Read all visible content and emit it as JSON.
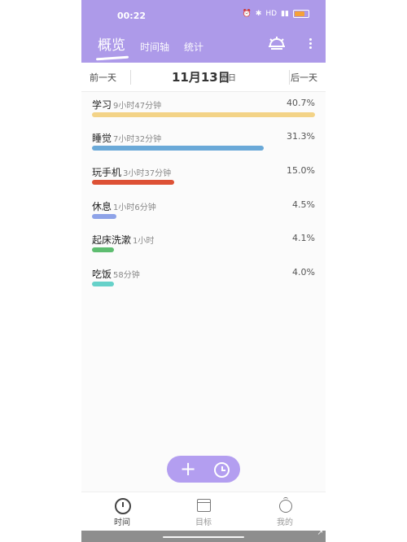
{
  "status_bar": {
    "time": "00:22",
    "icons": [
      "alarm-icon",
      "bluetooth-icon",
      "hd-icon",
      "signal-icon",
      "battery-icon"
    ]
  },
  "header": {
    "tabs": [
      "概览",
      "时间轴",
      "统计"
    ],
    "icons": [
      "sunrise-icon",
      "more-vertical-icon"
    ],
    "background": "#ad9ae9"
  },
  "date_bar": {
    "prev": "前一天",
    "date": "11月13日",
    "weekday": "周日",
    "next": "后一天"
  },
  "activities": [
    {
      "name": "学习",
      "duration": "9小时47分钟",
      "percent": "40.7%",
      "color": "#f3d387",
      "fraction": 1.0
    },
    {
      "name": "睡觉",
      "duration": "7小时32分钟",
      "percent": "31.3%",
      "color": "#6aa9d8",
      "fraction": 0.77
    },
    {
      "name": "玩手机",
      "duration": "3小时37分钟",
      "percent": "15.0%",
      "color": "#dd5135",
      "fraction": 0.37
    },
    {
      "name": "休息",
      "duration": "1小时6分钟",
      "percent": "4.5%",
      "color": "#8ea3e8",
      "fraction": 0.11
    },
    {
      "name": "起床洗漱",
      "duration": "1小时",
      "percent": "4.1%",
      "color": "#5ebd70",
      "fraction": 0.1
    },
    {
      "name": "吃饭",
      "duration": "58分钟",
      "percent": "4.0%",
      "color": "#66d1c9",
      "fraction": 0.1
    }
  ],
  "fab": {
    "plus": "+"
  },
  "bottom_nav": [
    {
      "label": "时间",
      "icon": "clock-calendar-icon",
      "active": true
    },
    {
      "label": "目标",
      "icon": "calendar-icon",
      "active": false
    },
    {
      "label": "我的",
      "icon": "tomato-icon",
      "active": false
    }
  ],
  "system": {
    "corner": "↗"
  }
}
